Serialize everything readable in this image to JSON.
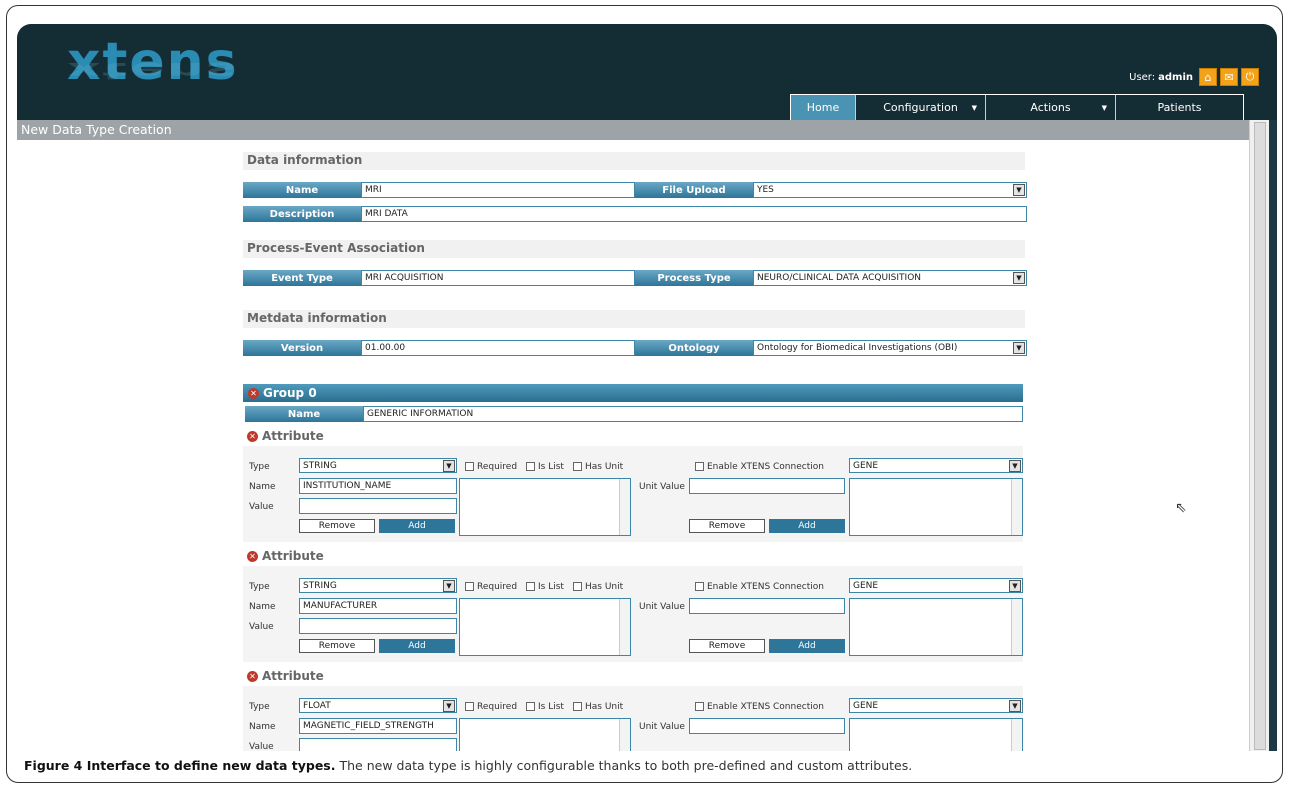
{
  "app": {
    "logo": "xtens",
    "user_prefix": "User:",
    "user": "admin",
    "icons": [
      "home-icon",
      "mail-icon",
      "power-icon"
    ]
  },
  "nav": {
    "home": "Home",
    "configuration": "Configuration",
    "actions": "Actions",
    "patients": "Patients"
  },
  "page_title": "New Data Type Creation",
  "data_info": {
    "title": "Data information",
    "name_label": "Name",
    "name_value": "MRI",
    "file_upload_label": "File Upload",
    "file_upload_value": "YES",
    "description_label": "Description",
    "description_value": "MRI DATA"
  },
  "process": {
    "title": "Process-Event Association",
    "event_label": "Event Type",
    "event_value": "MRI ACQUISITION",
    "process_label": "Process Type",
    "process_value": "NEURO/CLINICAL DATA ACQUISITION"
  },
  "meta": {
    "title": "Metdata information",
    "version_label": "Version",
    "version_value": "01.00.00",
    "ontology_label": "Ontology",
    "ontology_value": "Ontology for Biomedical Investigations (OBI)"
  },
  "group": {
    "title": "Group 0",
    "name_label": "Name",
    "name_value": "GENERIC INFORMATION"
  },
  "attr_labels": {
    "heading": "Attribute",
    "type": "Type",
    "name": "Name",
    "value": "Value",
    "required": "Required",
    "is_list": "Is List",
    "has_unit": "Has Unit",
    "unit_value": "Unit Value",
    "enable": "Enable XTENS Connection",
    "remove": "Remove",
    "add": "Add"
  },
  "attributes": [
    {
      "type": "STRING",
      "name": "INSTITUTION_NAME",
      "connection": "GENE"
    },
    {
      "type": "STRING",
      "name": "MANUFACTURER",
      "connection": "GENE"
    },
    {
      "type": "FLOAT",
      "name": "MAGNETIC_FIELD_STRENGTH",
      "connection": "GENE"
    }
  ],
  "caption": {
    "bold": "Figure 4 Interface to define new data types.",
    "text": "The new data type is highly configurable thanks to both pre-defined and custom attributes."
  }
}
